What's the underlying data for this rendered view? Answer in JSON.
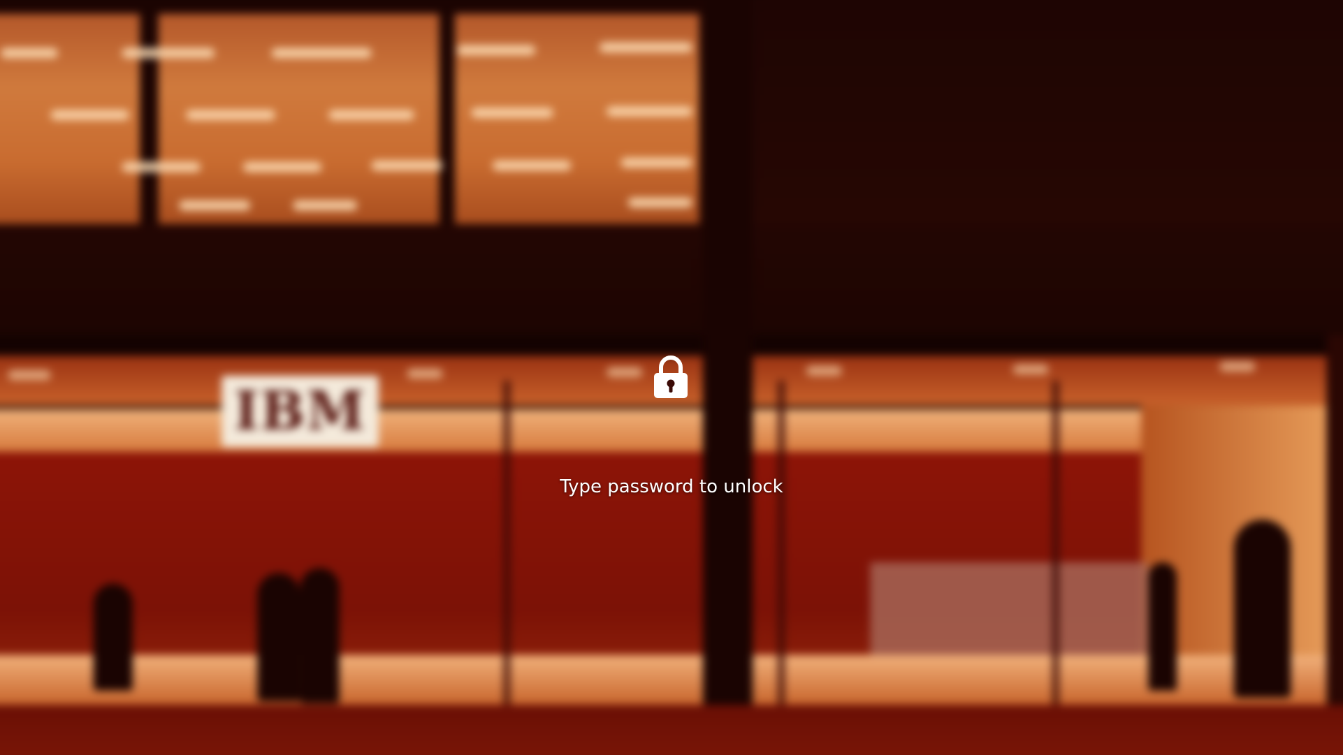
{
  "wallpaper": {
    "sign_text": "IBM"
  },
  "lock_screen": {
    "icon": "lock-icon",
    "prompt": "Type password to unlock"
  }
}
